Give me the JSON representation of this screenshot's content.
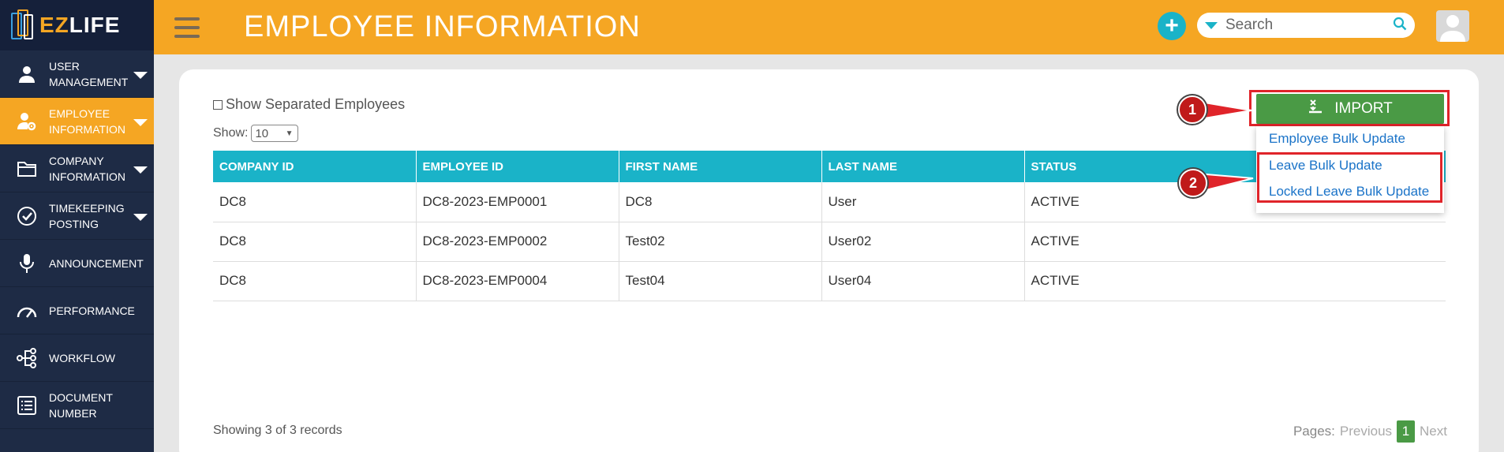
{
  "brand": {
    "ez": "EZ",
    "life": "LIFE"
  },
  "sidebar": {
    "items": [
      {
        "label": "USER MANAGEMENT",
        "icon": "user-icon",
        "caret": true,
        "active": false
      },
      {
        "label": "EMPLOYEE INFORMATION",
        "icon": "employee-gear-icon",
        "caret": true,
        "active": true
      },
      {
        "label": "COMPANY INFORMATION",
        "icon": "folder-icon",
        "caret": true,
        "active": false
      },
      {
        "label": "TIMEKEEPING POSTING",
        "icon": "check-circle-icon",
        "caret": true,
        "active": false
      },
      {
        "label": "ANNOUNCEMENT",
        "icon": "microphone-icon",
        "caret": false,
        "active": false
      },
      {
        "label": "PERFORMANCE",
        "icon": "gauge-icon",
        "caret": false,
        "active": false
      },
      {
        "label": "WORKFLOW",
        "icon": "workflow-icon",
        "caret": false,
        "active": false
      },
      {
        "label": "DOCUMENT NUMBER",
        "icon": "list-icon",
        "caret": false,
        "active": false
      }
    ]
  },
  "header": {
    "title": "EMPLOYEE INFORMATION",
    "search_placeholder": "Search"
  },
  "filters": {
    "show_separated_label": "Show Separated Employees",
    "show_label": "Show:",
    "page_size": "10"
  },
  "table": {
    "columns": [
      "COMPANY ID",
      "EMPLOYEE ID",
      "FIRST NAME",
      "LAST NAME",
      "STATUS"
    ],
    "rows": [
      [
        "DC8",
        "DC8-2023-EMP0001",
        "DC8",
        "User",
        "ACTIVE"
      ],
      [
        "DC8",
        "DC8-2023-EMP0002",
        "Test02",
        "User02",
        "ACTIVE"
      ],
      [
        "DC8",
        "DC8-2023-EMP0004",
        "Test04",
        "User04",
        "ACTIVE"
      ]
    ]
  },
  "footer": {
    "records": "Showing 3 of 3 records",
    "pages_label": "Pages:",
    "previous": "Previous",
    "current_page": "1",
    "next": "Next"
  },
  "import": {
    "label": "IMPORT",
    "menu": [
      "Employee Bulk Update",
      "Leave Bulk Update",
      "Locked Leave Bulk Update"
    ]
  },
  "markers": [
    "1",
    "2"
  ],
  "colors": {
    "accent": "#f5a623",
    "sidebar": "#1e2b45",
    "table_header": "#1ab3c8",
    "import_green": "#4a9a45",
    "highlight_red": "#e0242a"
  }
}
